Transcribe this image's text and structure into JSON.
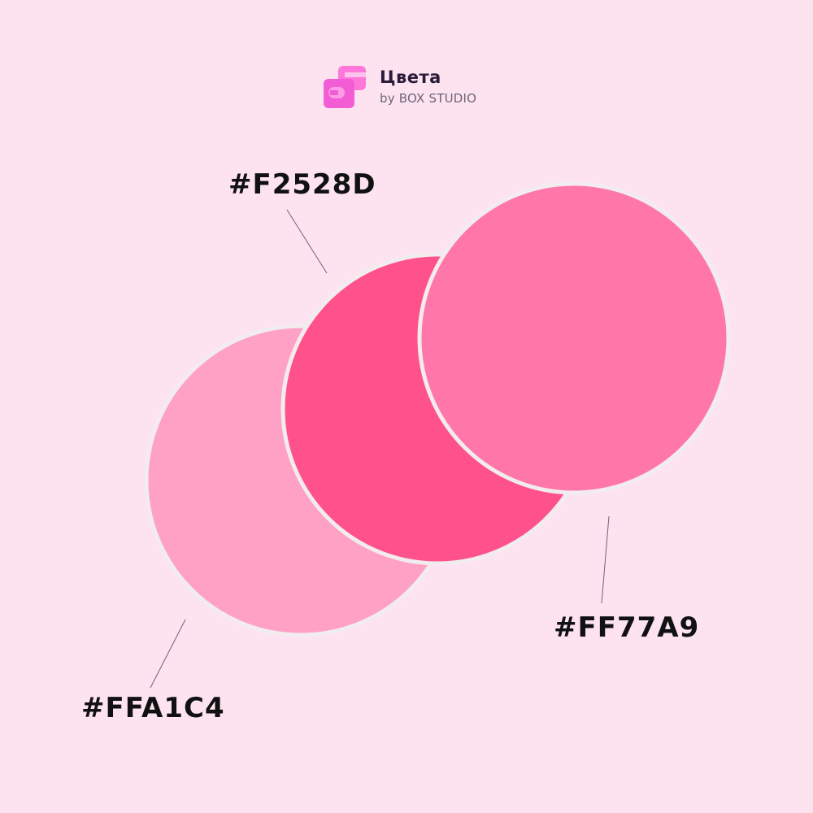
{
  "header": {
    "title": "Цвета",
    "subtitle": "by BOX STUDIO",
    "logo_icon": "box-studio-logo-icon"
  },
  "background_color": "#FDE3F0",
  "swatches": [
    {
      "hex": "#FFA1C4",
      "color": "#FFA1C4"
    },
    {
      "hex": "#F2528D",
      "color": "#FF528D"
    },
    {
      "hex": "#FF77A9",
      "color": "#FF77A9"
    }
  ]
}
